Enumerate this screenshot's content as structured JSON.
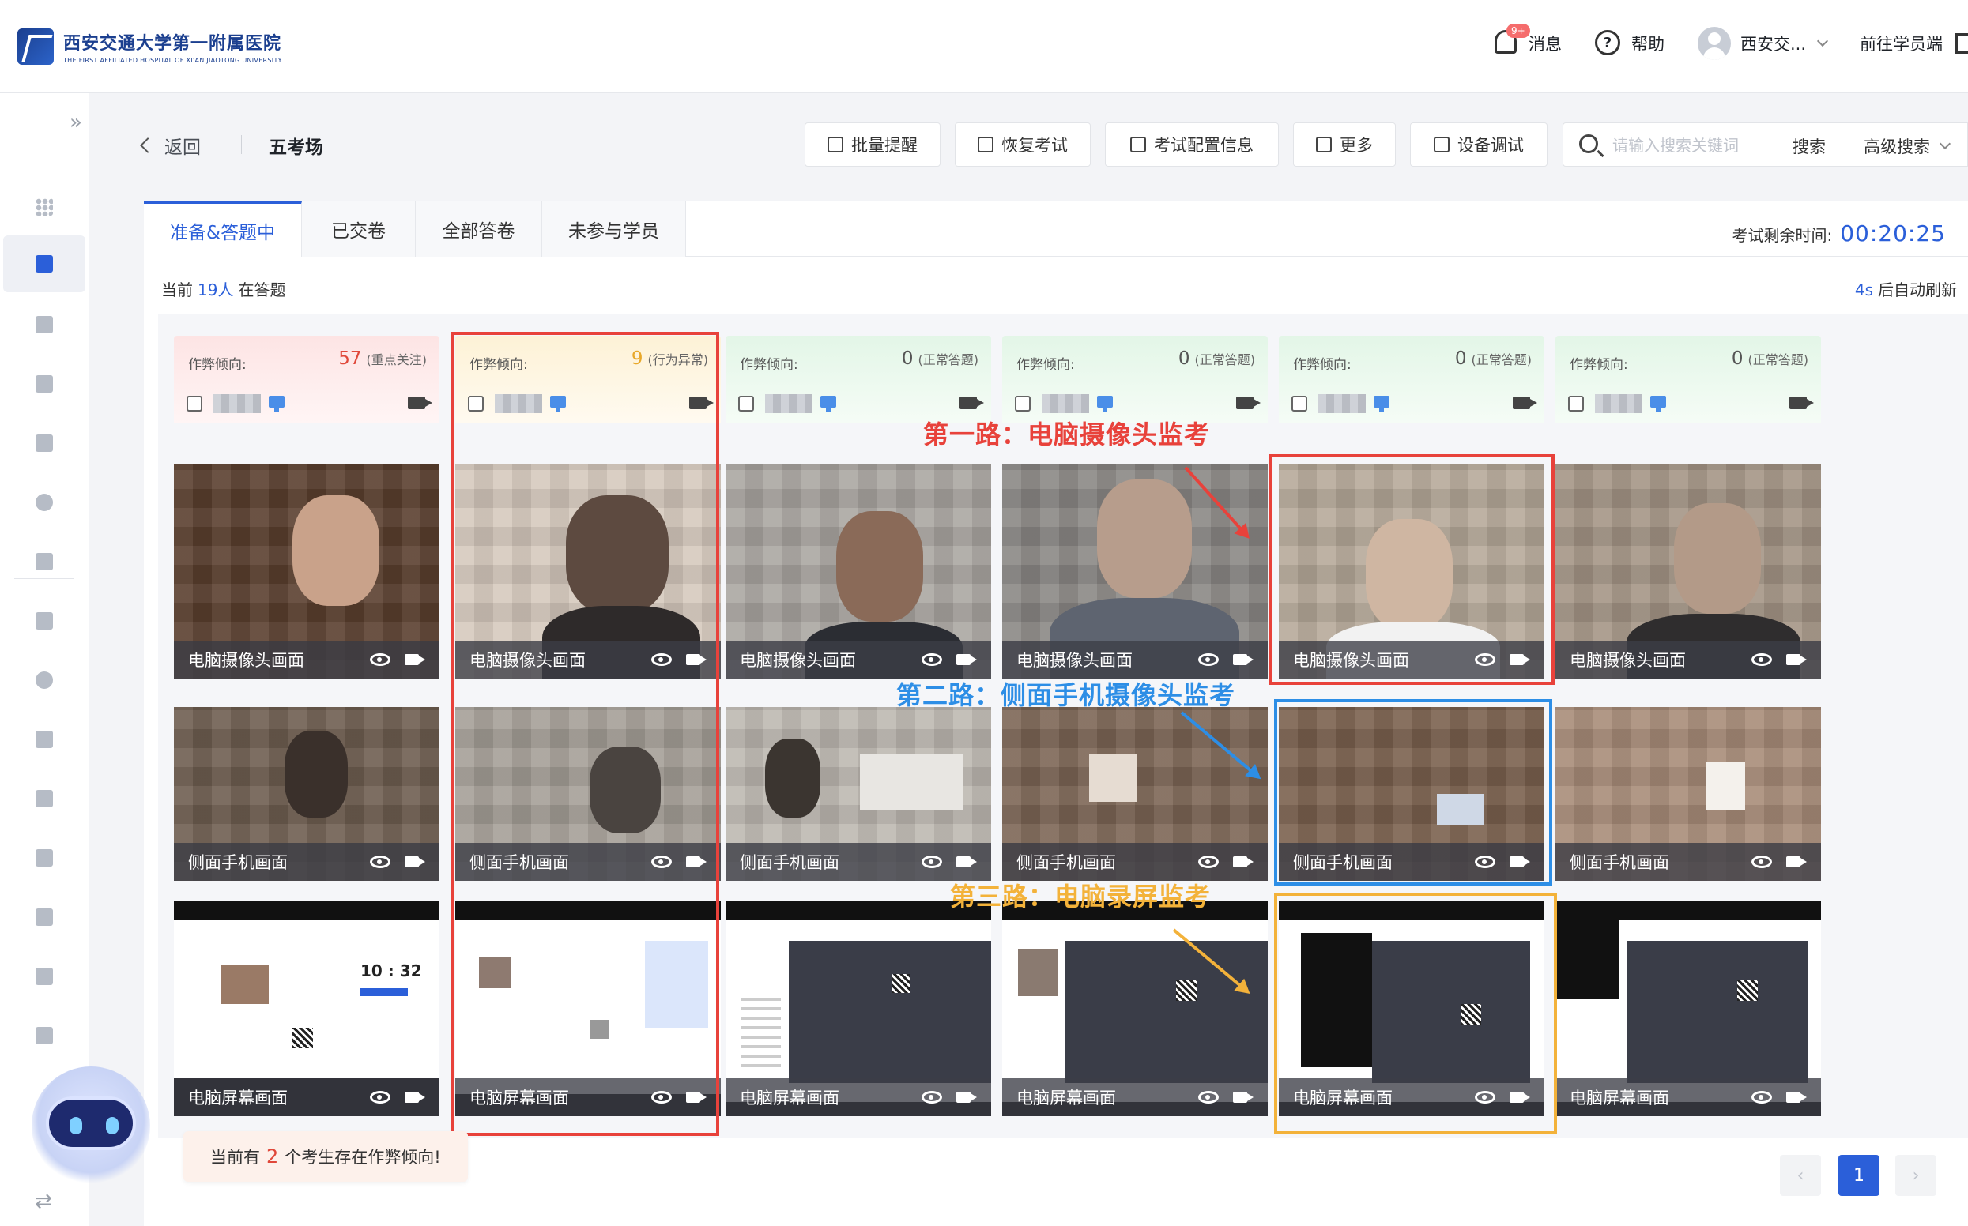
{
  "brand": {
    "name_cn": "西安交通大学第一附属医院",
    "name_en": "THE FIRST AFFILIATED HOSPITAL OF XI'AN JIAOTONG UNIVERSITY"
  },
  "topbar": {
    "badge": "9+",
    "messages": "消息",
    "help": "帮助",
    "user": "西安交...",
    "student_portal": "前往学员端"
  },
  "header": {
    "back": "返回",
    "title": "五考场",
    "buttons": [
      "批量提醒",
      "恢复考试",
      "考试配置信息",
      "更多",
      "设备调试"
    ],
    "search_placeholder": "请输入搜索关键词",
    "search": "搜索",
    "advanced_search": "高级搜索"
  },
  "tabs": [
    "准备&答题中",
    "已交卷",
    "全部答卷",
    "未参与学员"
  ],
  "timer": {
    "label": "考试剩余时间:",
    "value": "00:20:25"
  },
  "status": {
    "prefix": "当前",
    "count": "19人",
    "suffix": "在答题"
  },
  "refresh": {
    "seconds": "4s",
    "suffix": "后自动刷新"
  },
  "cheat_label": "作弊倾向:",
  "feed_labels": {
    "camera": "电脑摄像头画面",
    "phone": "侧面手机画面",
    "screen": "电脑屏幕画面"
  },
  "students": [
    {
      "score": "57",
      "note": "(重点关注)",
      "level": "red"
    },
    {
      "score": "9",
      "note": "(行为异常)",
      "level": "yellow"
    },
    {
      "score": "0",
      "note": "(正常答题)",
      "level": "green"
    },
    {
      "score": "0",
      "note": "(正常答题)",
      "level": "green"
    },
    {
      "score": "0",
      "note": "(正常答题)",
      "level": "green"
    },
    {
      "score": "0",
      "note": "(正常答题)",
      "level": "green"
    }
  ],
  "screen_clock": "10 : 32",
  "annotations": {
    "first": "第一路：电脑摄像头监考",
    "second": "第二路：侧面手机摄像头监考",
    "third": "第三路：电脑录屏监考"
  },
  "toast": {
    "prefix": "当前有",
    "count": "2",
    "suffix": "个考生存在作弊倾向!"
  },
  "pagination": {
    "prev": "‹",
    "page": "1",
    "next": "›"
  },
  "colors": {
    "accent": "#2b5fd9",
    "alert_red": "#e8423b",
    "annot_blue": "#2d8ee6",
    "annot_orange": "#f3b23a"
  }
}
